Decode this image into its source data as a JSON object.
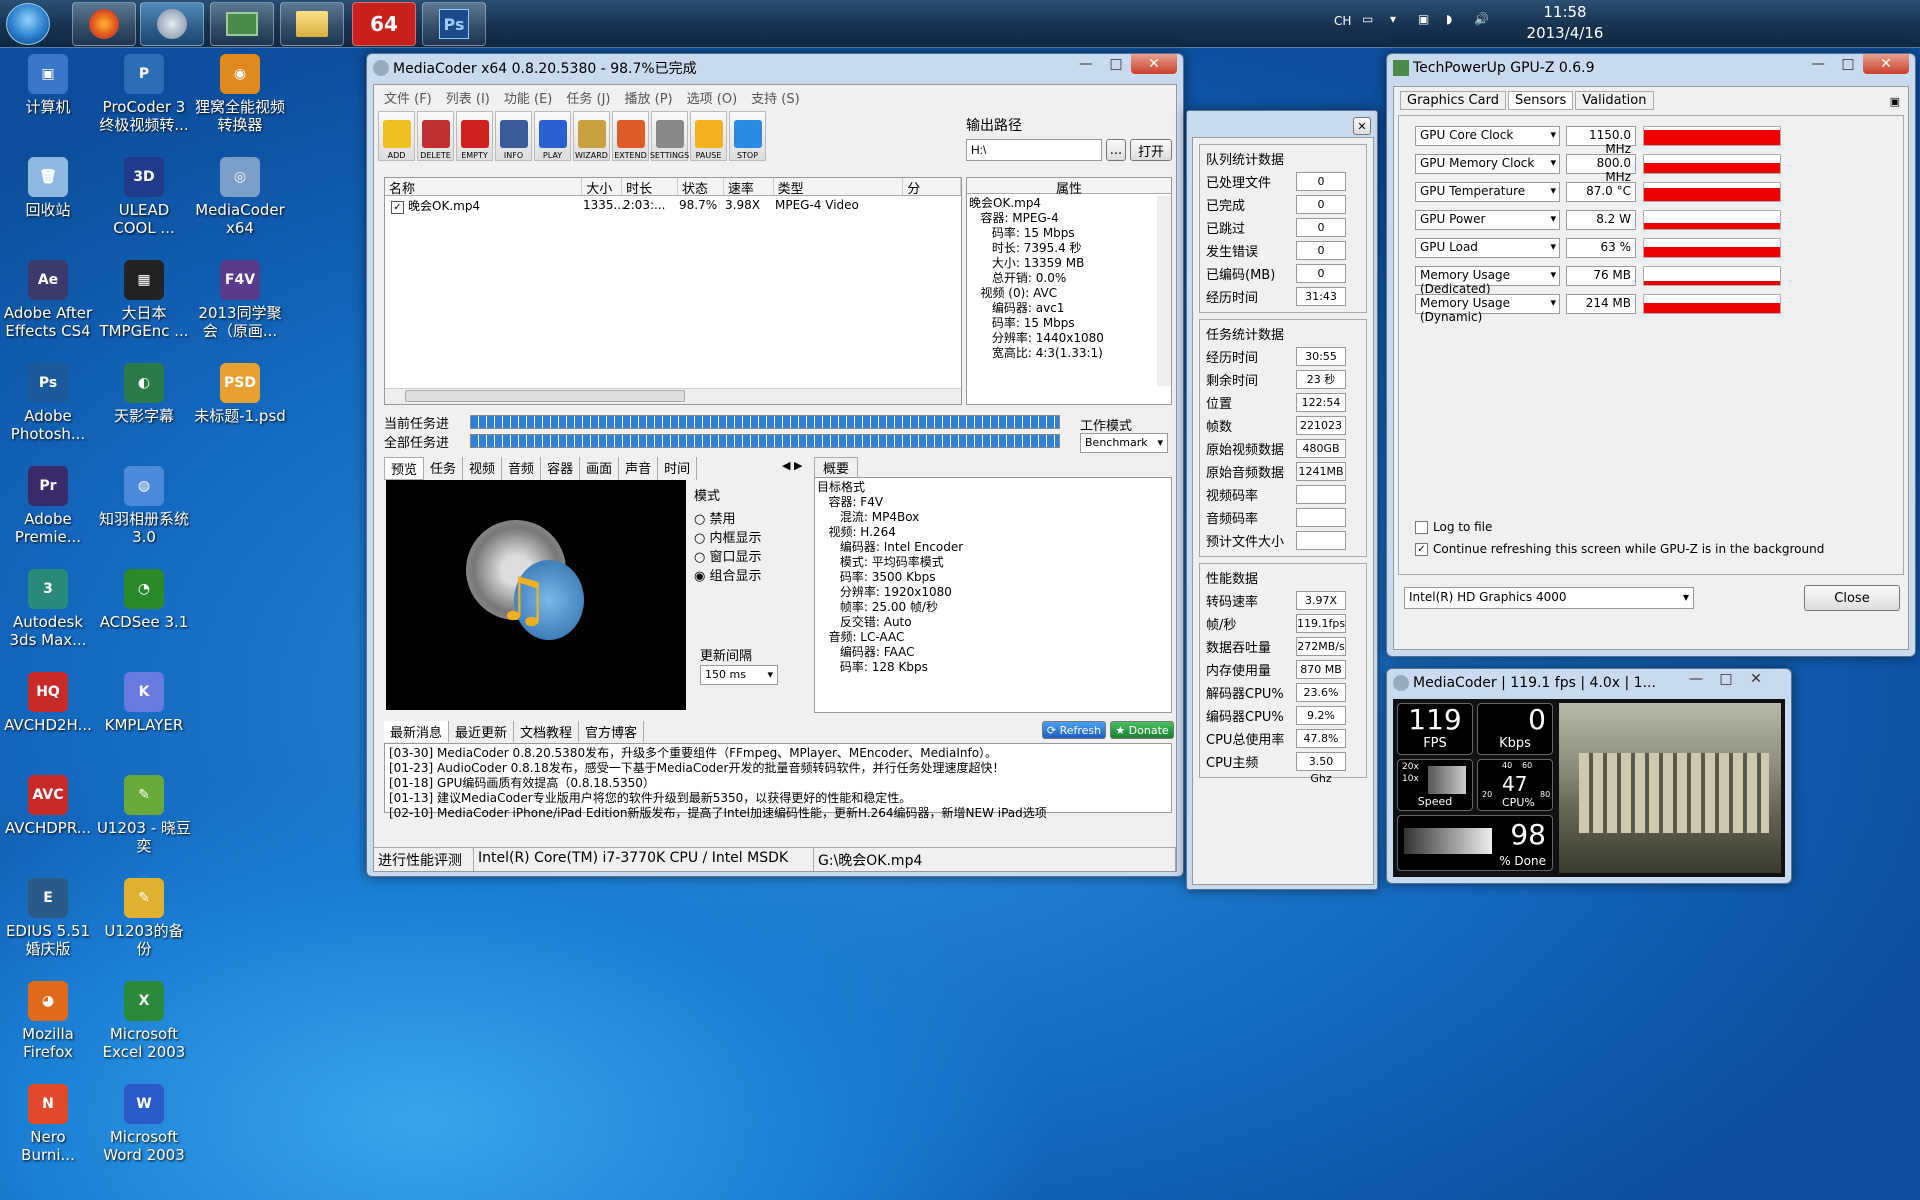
{
  "taskbar": {
    "apps": [
      "firefox",
      "mediacoder",
      "gpu-z",
      "explorer",
      "64",
      "Ps"
    ],
    "lang": "CH",
    "time": "11:58",
    "date": "2013/4/16"
  },
  "desktop_icons": [
    {
      "label": "计算机",
      "color": "#3a77c8",
      "glyph": "▣"
    },
    {
      "label": "ProCoder 3\n终极视频转...",
      "color": "#2c6db5",
      "glyph": "P"
    },
    {
      "label": "狸窝全能视频\n转换器",
      "color": "#e08a1e",
      "glyph": "◉"
    },
    {
      "label": "回收站",
      "color": "#8fb8e0",
      "glyph": "🗑"
    },
    {
      "label": "ULEAD\nCOOL ...",
      "color": "#223a8a",
      "glyph": "3D"
    },
    {
      "label": "MediaCoder\nx64",
      "color": "#7a9fc8",
      "glyph": "◎"
    },
    {
      "label": "Adobe After\nEffects CS4",
      "color": "#3b3b6b",
      "glyph": "Ae"
    },
    {
      "label": "大日本\nTMPGEnc ...",
      "color": "#222",
      "glyph": "▦"
    },
    {
      "label": "2013同学聚\n会（原画...",
      "color": "#5a3a8a",
      "glyph": "F4V"
    },
    {
      "label": "Adobe\nPhotosh...",
      "color": "#1d5a9a",
      "glyph": "Ps"
    },
    {
      "label": "天影字幕",
      "color": "#2a7a4a",
      "glyph": "◐"
    },
    {
      "label": "未标题-1.psd",
      "color": "#e8a030",
      "glyph": "PSD"
    },
    {
      "label": "Adobe\nPremie...",
      "color": "#3a2a6a",
      "glyph": "Pr"
    },
    {
      "label": "知羽相册系统\n3.0",
      "color": "#4a8ad8",
      "glyph": "◍"
    },
    {
      "label": "Autodesk\n3ds Max...",
      "color": "#2a8a7a",
      "glyph": "3"
    },
    {
      "label": "ACDSee 3.1",
      "color": "#2a8a2a",
      "glyph": "◔"
    },
    {
      "label": "AVCHD2H...",
      "color": "#c82a2a",
      "glyph": "HQ"
    },
    {
      "label": "KMPLAYER",
      "color": "#6a7ae0",
      "glyph": "K"
    },
    {
      "label": "AVCHDPR...",
      "color": "#c82a2a",
      "glyph": "AVC"
    },
    {
      "label": "U1203 - 晓豆\n奕",
      "color": "#6aaa3a",
      "glyph": "✎"
    },
    {
      "label": "EDIUS 5.51\n婚庆版",
      "color": "#2a5a8a",
      "glyph": "E"
    },
    {
      "label": "U1203的备\n份",
      "color": "#e0b030",
      "glyph": "✎"
    },
    {
      "label": "Mozilla\nFirefox",
      "color": "#e06a1a",
      "glyph": "◕"
    },
    {
      "label": "Microsoft\nExcel 2003",
      "color": "#2a8a3a",
      "glyph": "X"
    },
    {
      "label": "Nero\nBurni...",
      "color": "#e04a2a",
      "glyph": "N"
    },
    {
      "label": "Microsoft\nWord 2003",
      "color": "#2a5ac8",
      "glyph": "W"
    }
  ],
  "mediacoder": {
    "title": "MediaCoder x64 0.8.20.5380 - 98.7%已完成",
    "menu": [
      "文件 (F)",
      "列表 (I)",
      "功能 (E)",
      "任务 (J)",
      "播放 (P)",
      "选项 (O)",
      "支持 (S)"
    ],
    "tools": [
      {
        "label": "ADD",
        "color": "#f0c020"
      },
      {
        "label": "DELETE",
        "color": "#c03030"
      },
      {
        "label": "EMPTY",
        "color": "#d02020"
      },
      {
        "label": "INFO",
        "color": "#3a5a9a"
      },
      {
        "label": "PLAY",
        "color": "#2a60d0"
      },
      {
        "label": "WIZARD",
        "color": "#c8a040"
      },
      {
        "label": "EXTEND",
        "color": "#e05a2a"
      },
      {
        "label": "SETTINGS",
        "color": "#888"
      },
      {
        "label": "PAUSE",
        "color": "#f0b020"
      },
      {
        "label": "STOP",
        "color": "#2a8ae0"
      }
    ],
    "output_label": "输出路径",
    "output_value": "H:\\",
    "browse": "...",
    "open": "打开",
    "list_headers": [
      "名称",
      "大小",
      "时长",
      "状态",
      "速率",
      "类型",
      "分"
    ],
    "file": {
      "name": "晚会OK.mp4",
      "size": "1335...",
      "duration": "2:03:...",
      "status": "98.7%",
      "rate": "3.98X",
      "type": "MPEG-4 Video"
    },
    "props_header": "属性",
    "props": [
      "晚会OK.mp4",
      "   容器: MPEG-4",
      "      码率: 15 Mbps",
      "      时长: 7395.4 秒",
      "      大小: 13359 MB",
      "      总开销: 0.0%",
      "   视频 (0): AVC",
      "      编码器: avc1",
      "      码率: 15 Mbps",
      "      分辨率: 1440x1080",
      "      宽高比: 4:3(1.33:1)"
    ],
    "cur_task": "当前任务进",
    "all_task": "全部任务进",
    "work_mode": "工作模式",
    "work_mode_val": "Benchmark",
    "tabs": [
      "预览",
      "任务",
      "视频",
      "音频",
      "容器",
      "画面",
      "声音",
      "时间"
    ],
    "summary_tab": "概要",
    "mode_label": "模式",
    "modes": [
      "禁用",
      "内框显示",
      "窗口显示",
      "组合显示"
    ],
    "interval_label": "更新间隔",
    "interval_val": "150 ms",
    "summary": [
      "目标格式",
      "   容器: F4V",
      "      混流: MP4Box",
      "   视频: H.264",
      "      编码器: Intel Encoder",
      "      模式: 平均码率模式",
      "      码率: 3500 Kbps",
      "      分辨率: 1920x1080",
      "      帧率: 25.00 帧/秒",
      "      反交错: Auto",
      "   音频: LC-AAC",
      "      编码器: FAAC",
      "      码率: 128 Kbps"
    ],
    "news_tabs": [
      "最新消息",
      "最近更新",
      "文档教程",
      "官方博客"
    ],
    "refresh": "Refresh",
    "donate": "Donate",
    "news": [
      "[03-30] MediaCoder 0.8.20.5380发布，升级多个重要组件（FFmpeg、MPlayer、MEncoder、MediaInfo）。",
      "[01-23] AudioCoder 0.8.18发布，感受一下基于MediaCoder开发的批量音频转码软件，并行任务处理速度超快！",
      "[01-18] GPU编码画质有效提高（0.8.18.5350）",
      "[01-13] 建议MediaCoder专业版用户将您的软件升级到最新5350，以获得更好的性能和稳定性。",
      "[02-10] MediaCoder iPhone/iPad Edition新版发布，提高了Intel加速编码性能，更新H.264编码器，新增NEW iPad选项"
    ],
    "status": [
      "进行性能评测",
      "Intel(R) Core(TM) i7-3770K CPU  / Intel MSDK",
      "G:\\晚会OK.mp4"
    ]
  },
  "stats": {
    "queue_title": "队列统计数据",
    "queue": [
      [
        "已处理文件",
        "0"
      ],
      [
        "已完成",
        "0"
      ],
      [
        "已跳过",
        "0"
      ],
      [
        "发生错误",
        "0"
      ],
      [
        "已编码(MB)",
        "0"
      ],
      [
        "经历时间",
        "31:43"
      ]
    ],
    "task_title": "任务统计数据",
    "task": [
      [
        "经历时间",
        "30:55"
      ],
      [
        "剩余时间",
        "23 秒"
      ],
      [
        "位置",
        "122:54"
      ],
      [
        "帧数",
        "221023"
      ],
      [
        "原始视频数据",
        "480GB"
      ],
      [
        "原始音频数据",
        "1241MB"
      ],
      [
        "视频码率",
        ""
      ],
      [
        "音频码率",
        ""
      ],
      [
        "预计文件大小",
        ""
      ]
    ],
    "perf_title": "性能数据",
    "perf": [
      [
        "转码速率",
        "3.97X"
      ],
      [
        "帧/秒",
        "119.1fps"
      ],
      [
        "数据吞吐量",
        "272MB/s"
      ],
      [
        "内存使用量",
        "870 MB"
      ],
      [
        "解码器CPU%",
        "23.6%"
      ],
      [
        "编码器CPU%",
        "9.2%"
      ],
      [
        "CPU总使用率",
        "47.8%"
      ],
      [
        "CPU主频",
        "3.50 Ghz"
      ]
    ]
  },
  "gpuz": {
    "title": "TechPowerUp GPU-Z 0.6.9",
    "tabs": [
      "Graphics Card",
      "Sensors",
      "Validation"
    ],
    "sensors": [
      {
        "name": "GPU Core Clock",
        "value": "1150.0 MHz",
        "level": 0.85
      },
      {
        "name": "GPU Memory Clock",
        "value": "800.0 MHz",
        "level": 0.55
      },
      {
        "name": "GPU Temperature",
        "value": "87.0 °C",
        "level": 0.75
      },
      {
        "name": "GPU Power",
        "value": "8.2 W",
        "level": 0.35
      },
      {
        "name": "GPU Load",
        "value": "63 %",
        "level": 0.55
      },
      {
        "name": "Memory Usage (Dedicated)",
        "value": "76 MB",
        "level": 0.25
      },
      {
        "name": "Memory Usage (Dynamic)",
        "value": "214 MB",
        "level": 0.55
      }
    ],
    "log_to_file": "Log to file",
    "continue_refresh": "Continue refreshing this screen while GPU-Z is in the background",
    "device": "Intel(R) HD Graphics 4000",
    "close": "Close"
  },
  "mini": {
    "title": "MediaCoder | 119.1 fps | 4.0x | 1...",
    "fps": "119",
    "fps_label": "FPS",
    "kbps": "0",
    "kbps_label": "Kbps",
    "speed_label": "Speed",
    "speed_marks": [
      "20x",
      "10x"
    ],
    "cpu": "47",
    "cpu_label": "CPU%",
    "cpu_marks": [
      "40",
      "60",
      "20",
      "80"
    ],
    "done": "98",
    "done_label": "% Done",
    "progress": 0.98
  }
}
